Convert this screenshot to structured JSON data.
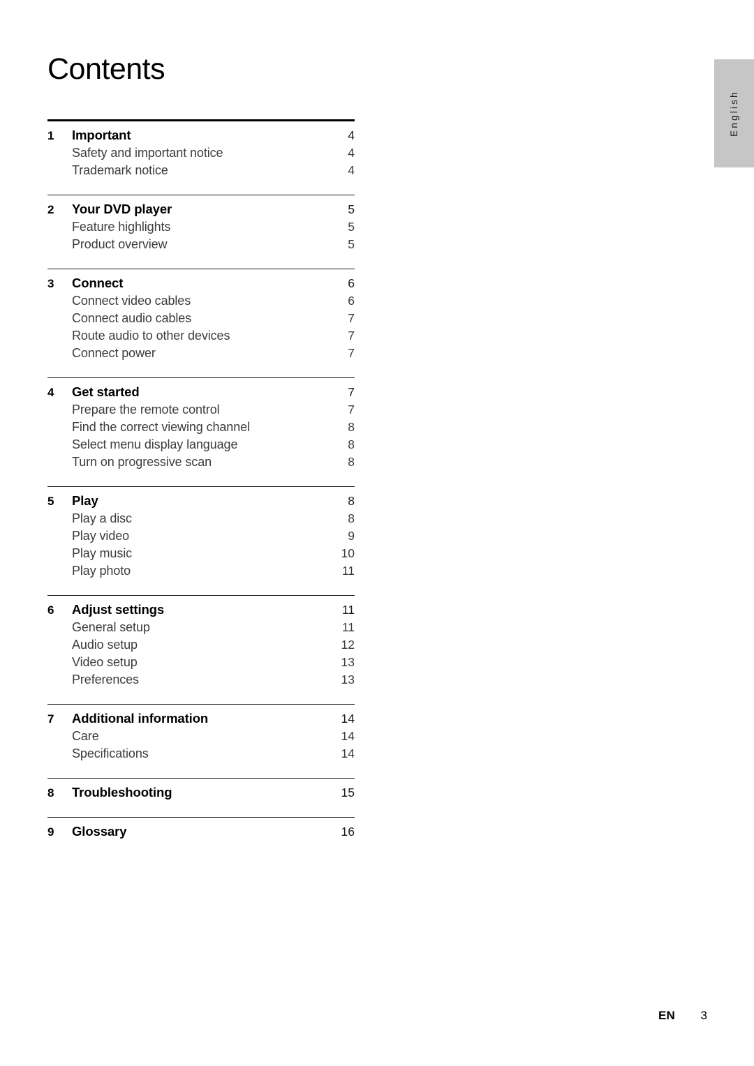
{
  "page_title": "Contents",
  "language_tab": {
    "label": "English"
  },
  "footer": {
    "locale": "EN",
    "page_number": "3"
  },
  "toc": {
    "groups": [
      {
        "rule": "thick",
        "section": {
          "num": "1",
          "label": "Important",
          "page": "4"
        },
        "items": [
          {
            "label": "Safety and important notice",
            "page": "4"
          },
          {
            "label": "Trademark notice",
            "page": "4"
          }
        ]
      },
      {
        "rule": "thin",
        "section": {
          "num": "2",
          "label": "Your DVD player",
          "page": "5"
        },
        "items": [
          {
            "label": "Feature highlights",
            "page": "5"
          },
          {
            "label": "Product overview",
            "page": "5"
          }
        ]
      },
      {
        "rule": "thin",
        "section": {
          "num": "3",
          "label": "Connect",
          "page": "6"
        },
        "items": [
          {
            "label": "Connect video cables",
            "page": "6"
          },
          {
            "label": "Connect audio cables",
            "page": "7"
          },
          {
            "label": "Route audio to other devices",
            "page": "7"
          },
          {
            "label": "Connect power",
            "page": "7"
          }
        ]
      },
      {
        "rule": "thin",
        "section": {
          "num": "4",
          "label": "Get started",
          "page": "7"
        },
        "items": [
          {
            "label": "Prepare the remote control",
            "page": "7"
          },
          {
            "label": "Find the correct viewing channel",
            "page": "8"
          },
          {
            "label": "Select menu display language",
            "page": "8"
          },
          {
            "label": "Turn on progressive scan",
            "page": "8"
          }
        ]
      },
      {
        "rule": "thin",
        "section": {
          "num": "5",
          "label": "Play",
          "page": "8"
        },
        "items": [
          {
            "label": "Play a disc",
            "page": "8"
          },
          {
            "label": "Play video",
            "page": "9"
          },
          {
            "label": "Play music",
            "page": "10"
          },
          {
            "label": "Play photo",
            "page": "11"
          }
        ]
      },
      {
        "rule": "thin",
        "section": {
          "num": "6",
          "label": "Adjust settings",
          "page": "11"
        },
        "items": [
          {
            "label": "General setup",
            "page": "11"
          },
          {
            "label": "Audio setup",
            "page": "12"
          },
          {
            "label": "Video setup",
            "page": "13"
          },
          {
            "label": "Preferences",
            "page": "13"
          }
        ]
      },
      {
        "rule": "thin",
        "section": {
          "num": "7",
          "label": "Additional information",
          "page": "14"
        },
        "items": [
          {
            "label": "Care",
            "page": "14"
          },
          {
            "label": "Specifications",
            "page": "14"
          }
        ]
      },
      {
        "rule": "thin",
        "section": {
          "num": "8",
          "label": "Troubleshooting",
          "page": "15"
        },
        "items": []
      },
      {
        "rule": "thin",
        "section": {
          "num": "9",
          "label": "Glossary",
          "page": "16"
        },
        "items": []
      }
    ]
  }
}
